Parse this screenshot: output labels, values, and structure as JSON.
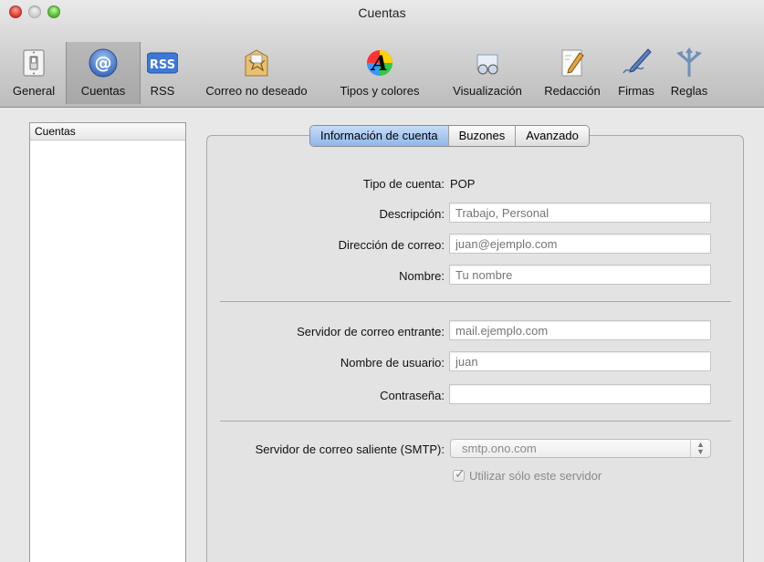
{
  "window": {
    "title": "Cuentas"
  },
  "toolbar": {
    "items": [
      {
        "label": "General",
        "icon": "light-switch-icon"
      },
      {
        "label": "Cuentas",
        "icon": "at-sign-icon",
        "selected": true
      },
      {
        "label": "RSS",
        "icon": "rss-icon"
      },
      {
        "label": "Correo no deseado",
        "icon": "junk-mail-icon"
      },
      {
        "label": "Tipos y colores",
        "icon": "fonts-colors-icon"
      },
      {
        "label": "Visualización",
        "icon": "viewing-glasses-icon"
      },
      {
        "label": "Redacción",
        "icon": "composing-pencil-icon"
      },
      {
        "label": "Firmas",
        "icon": "signature-pen-icon"
      },
      {
        "label": "Reglas",
        "icon": "rules-arrows-icon"
      }
    ]
  },
  "accounts_list": {
    "header": "Cuentas"
  },
  "tabs": [
    {
      "label": "Información de cuenta",
      "active": true
    },
    {
      "label": "Buzones"
    },
    {
      "label": "Avanzado"
    }
  ],
  "form": {
    "account_type": {
      "label": "Tipo de cuenta:",
      "value": "POP"
    },
    "description": {
      "label": "Descripción:",
      "placeholder": "Trabajo, Personal"
    },
    "email": {
      "label": "Dirección de correo:",
      "placeholder": "juan@ejemplo.com"
    },
    "name": {
      "label": "Nombre:",
      "placeholder": "Tu nombre"
    },
    "incoming_server": {
      "label": "Servidor de correo entrante:",
      "placeholder": "mail.ejemplo.com"
    },
    "username": {
      "label": "Nombre de usuario:",
      "placeholder": "juan"
    },
    "password": {
      "label": "Contraseña:",
      "placeholder": ""
    },
    "outgoing_server": {
      "label": "Servidor de correo saliente (SMTP):",
      "value": "smtp.ono.com"
    },
    "only_this_server": {
      "label": "Utilizar sólo este servidor",
      "checked": true
    }
  },
  "colors": {
    "tab_active": "#8fb6ea",
    "close": "#d6302a",
    "zoom": "#4caf2b"
  }
}
